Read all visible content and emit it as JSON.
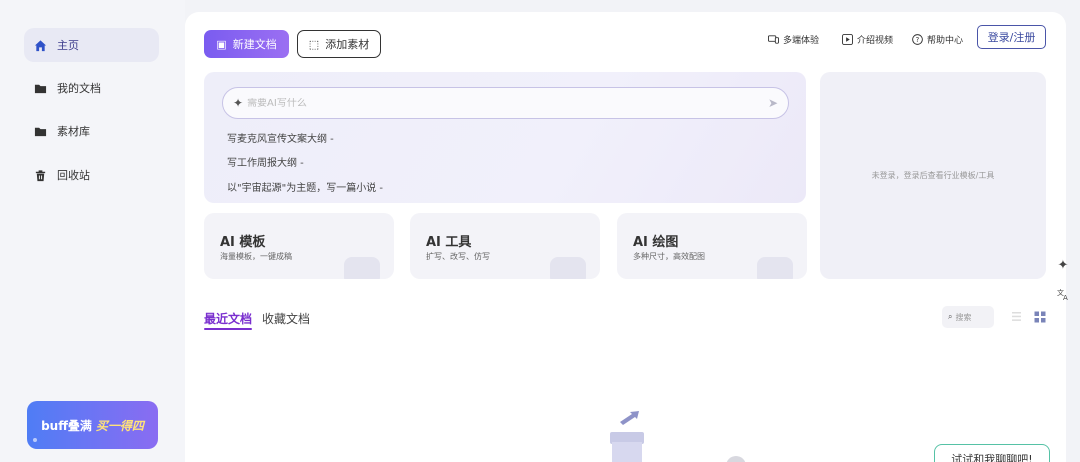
{
  "sidebar": {
    "items": [
      {
        "label": "主页",
        "icon": "home-icon",
        "active": true
      },
      {
        "label": "我的文档",
        "icon": "folder-icon",
        "active": false
      },
      {
        "label": "素材库",
        "icon": "folder-icon",
        "active": false
      },
      {
        "label": "回收站",
        "icon": "trash-icon",
        "active": false
      }
    ],
    "promo": {
      "label": "buff叠满",
      "highlight": "买一得四"
    }
  },
  "toolbar": {
    "new_doc": "新建文档",
    "add_material": "添加素材",
    "links": [
      {
        "label": "多端体验",
        "icon": "devices-icon"
      },
      {
        "label": "介绍视频",
        "icon": "play-icon"
      },
      {
        "label": "帮助中心",
        "icon": "help-icon"
      }
    ],
    "login": "登录/注册"
  },
  "prompt": {
    "placeholder": "需要AI写什么",
    "suggestions": [
      "写麦克风宣传文案大纲 -",
      "写工作周报大纲 -",
      "以\"宇宙起源\"为主题，写一篇小说 -"
    ]
  },
  "right_panel": {
    "text": "未登录，登录后查看行业模板/工具"
  },
  "tools": [
    {
      "title": "AI 模板",
      "subtitle": "海量模板，一键成稿"
    },
    {
      "title": "AI 工具",
      "subtitle": "扩写、改写、仿写"
    },
    {
      "title": "AI 绘图",
      "subtitle": "多种尺寸，高效配图"
    }
  ],
  "docs": {
    "tabs": [
      "最近文档",
      "收藏文档"
    ],
    "search_placeholder": "搜索"
  },
  "chat_button": "试试和我聊聊吧!",
  "colors": {
    "accent": "#7a5cf0",
    "tab_active": "#7a2fcf",
    "login_border": "#4a55a8"
  }
}
